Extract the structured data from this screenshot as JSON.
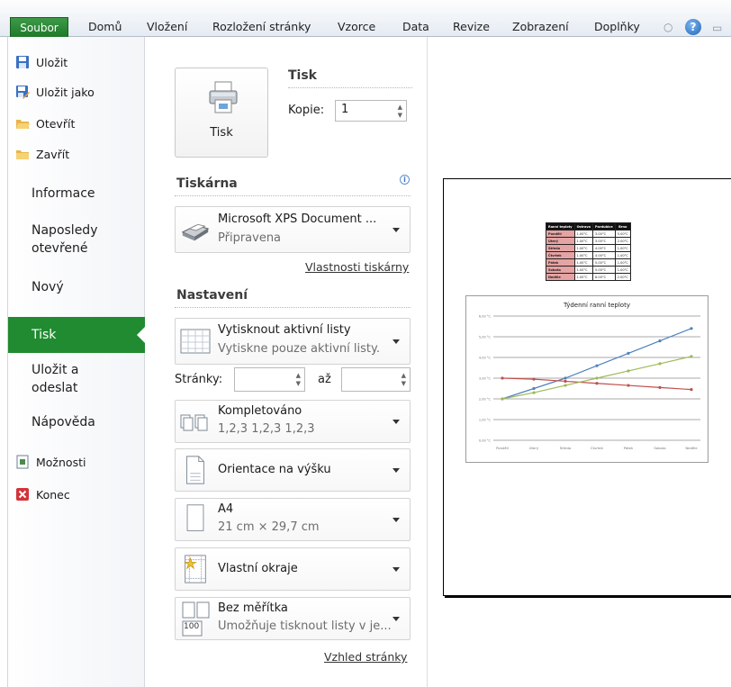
{
  "ribbon": {
    "file_tab": "Soubor",
    "tabs": [
      "Domů",
      "Vložení",
      "Rozložení stránky",
      "Vzorce",
      "Data",
      "Revize",
      "Zobrazení",
      "Doplňky"
    ],
    "help_label": "?"
  },
  "nav": {
    "commands": [
      {
        "label": "Uložit",
        "icon": "save-icon"
      },
      {
        "label": "Uložit jako",
        "icon": "save-as-icon"
      },
      {
        "label": "Otevřít",
        "icon": "open-folder-icon"
      },
      {
        "label": "Zavřít",
        "icon": "close-folder-icon"
      }
    ],
    "tab_info": "Informace",
    "tab_recent_1": "Naposledy",
    "tab_recent_2": "otevřené",
    "tab_new": "Nový",
    "tab_print": "Tisk",
    "tab_share_1": "Uložit a",
    "tab_share_2": "odeslat",
    "tab_help": "Nápověda",
    "options": "Možnosti",
    "exit": "Konec"
  },
  "print": {
    "section_title": "Tisk",
    "button_label": "Tisk",
    "copies_label": "Kopie:",
    "copies_value": "1"
  },
  "printer": {
    "section_title": "Tiskárna",
    "info_icon": "i",
    "name": "Microsoft XPS Document ...",
    "status": "Připravena",
    "properties_link": "Vlastnosti tiskárny"
  },
  "settings": {
    "section_title": "Nastavení",
    "what": {
      "title": "Vytisknout aktivní listy",
      "sub": "Vytiskne pouze aktivní listy."
    },
    "pages_label": "Stránky:",
    "pages_to": "až",
    "collate": {
      "title": "Kompletováno",
      "sub": "1,2,3   1,2,3   1,2,3"
    },
    "orientation": {
      "title": "Orientace na výšku"
    },
    "paper": {
      "title": "A4",
      "sub": "21 cm × 29,7 cm"
    },
    "margins": {
      "title": "Vlastní okraje"
    },
    "scaling": {
      "title": "Bez měřítka",
      "sub": "Umožňuje tisknout listy v je..."
    },
    "scaling_icon_text": "100",
    "page_setup_link": "Vzhled stránky"
  },
  "preview": {
    "table": {
      "headers": [
        "Ranní teploty",
        "Ostrava",
        "Pardubice",
        "Brno"
      ],
      "rows": [
        [
          "Pondělí",
          "1.00°C",
          "3.00°C",
          "5.00°C"
        ],
        [
          "Úterý",
          "1.00°C",
          "3.00°C",
          "2.00°C"
        ],
        [
          "Středa",
          "1.00°C",
          "4.00°C",
          "1.00°C"
        ],
        [
          "Čtvrtek",
          "1.00°C",
          "4.00°C",
          "1.00°C"
        ],
        [
          "Pátek",
          "1.00°C",
          "5.00°C",
          "1.00°C"
        ],
        [
          "Sobota",
          "1.00°C",
          "5.00°C",
          "1.00°C"
        ],
        [
          "Neděle",
          "1.00°C",
          "6.00°C",
          "2.00°C"
        ]
      ]
    }
  },
  "chart_data": {
    "type": "line",
    "title": "Týdenní ranní teploty",
    "categories": [
      "Pondělí",
      "Úterý",
      "Středa",
      "Čtvrtek",
      "Pátek",
      "Sobota",
      "Neděle"
    ],
    "y_tick_labels": [
      "0,00 °C",
      "1,00 °C",
      "2,00 °C",
      "3,00 °C",
      "4,00 °C",
      "5,00 °C",
      "6,00 °C"
    ],
    "ylim": [
      0,
      6
    ],
    "grid": true,
    "legend": "none",
    "series": [
      {
        "color": "#4f81bd",
        "values": [
          2.0,
          2.5,
          3.0,
          3.6,
          4.2,
          4.8,
          5.4
        ]
      },
      {
        "color": "#c0504d",
        "values": [
          3.0,
          2.95,
          2.85,
          2.75,
          2.65,
          2.55,
          2.45
        ]
      },
      {
        "color": "#9bbb59",
        "values": [
          2.0,
          2.3,
          2.65,
          3.0,
          3.35,
          3.7,
          4.05
        ]
      }
    ]
  },
  "colors": {
    "accent": "#208b30",
    "ribbon_bg": "#e5ebf3"
  }
}
